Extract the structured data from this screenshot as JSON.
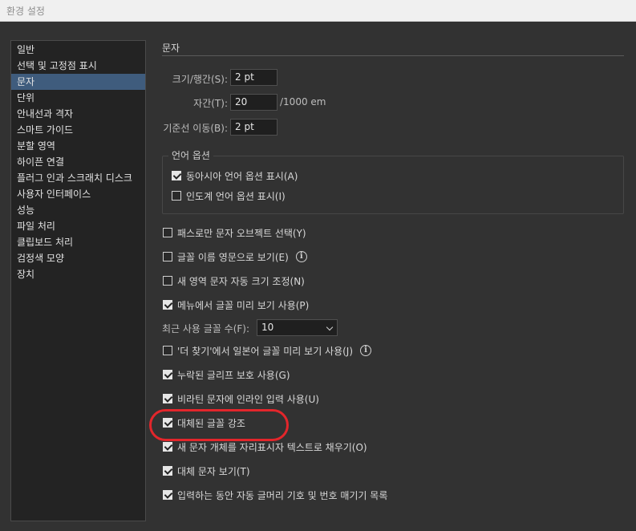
{
  "window": {
    "title": "환경 설정"
  },
  "sidebar": {
    "items": [
      {
        "label": "일반"
      },
      {
        "label": "선택 및 고정점 표시"
      },
      {
        "label": "문자"
      },
      {
        "label": "단위"
      },
      {
        "label": "안내선과 격자"
      },
      {
        "label": "스마트 가이드"
      },
      {
        "label": "분할 영역"
      },
      {
        "label": "하이픈 연결"
      },
      {
        "label": "플러그 인과 스크래치 디스크"
      },
      {
        "label": "사용자 인터페이스"
      },
      {
        "label": "성능"
      },
      {
        "label": "파일 처리"
      },
      {
        "label": "클립보드 처리"
      },
      {
        "label": "검정색 모양"
      },
      {
        "label": "장치"
      }
    ],
    "selected": "문자"
  },
  "panel": {
    "title": "문자",
    "size_leading": {
      "label": "크기/행간(S):",
      "value": "2 pt"
    },
    "tracking": {
      "label": "자간(T):",
      "value": "20",
      "unit": "/1000 em"
    },
    "baseline_shift": {
      "label": "기준선 이동(B):",
      "value": "2 pt"
    },
    "language_options": {
      "title": "언어 옵션",
      "east_asian": {
        "label": "동아시아 언어 옵션 표시(A)",
        "checked": true
      },
      "indic": {
        "label": "인도계 언어 옵션 표시(I)",
        "checked": false
      }
    },
    "options": [
      {
        "label": "패스로만 문자 오브젝트 선택(Y)",
        "checked": false,
        "info": false
      },
      {
        "label": "글꼴 이름 영문으로 보기(E)",
        "checked": false,
        "info": true
      },
      {
        "label": "새 영역 문자 자동 크기 조정(N)",
        "checked": false,
        "info": false
      },
      {
        "label": "메뉴에서 글꼴 미리 보기 사용(P)",
        "checked": true,
        "info": false
      }
    ],
    "recent_fonts": {
      "label": "최근 사용 글꼴 수(F):",
      "value": "10"
    },
    "options2": [
      {
        "label": "'더 찾기'에서 일본어 글꼴 미리 보기 사용(J)",
        "checked": false,
        "info": true
      },
      {
        "label": "누락된 글리프 보호 사용(G)",
        "checked": true,
        "info": false
      },
      {
        "label": "비라틴 문자에 인라인 입력 사용(U)",
        "checked": true,
        "info": false
      },
      {
        "label": "대체된 글꼴 강조",
        "checked": true,
        "info": false
      },
      {
        "label": "새 문자 개체를 자리표시자 텍스트로 채우기(O)",
        "checked": true,
        "info": false
      },
      {
        "label": "대체 문자 보기(T)",
        "checked": true,
        "info": false
      },
      {
        "label": "입력하는 동안 자동 글머리 기호 및 번호 매기기 목록",
        "checked": true,
        "info": false
      }
    ]
  },
  "colors": {
    "accent_selected": "#3f5c7d",
    "annotation_ring": "#e3262b",
    "background": "#323232"
  }
}
